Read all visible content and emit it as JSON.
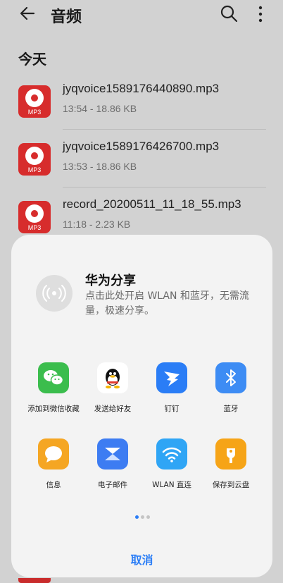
{
  "header": {
    "title": "音频"
  },
  "section_label": "今天",
  "files": [
    {
      "name": "jyqvoice1589176440890.mp3",
      "meta": "13:54 - 18.86 KB",
      "badge": "MP3"
    },
    {
      "name": "jyqvoice1589176426700.mp3",
      "meta": "13:53 - 18.86 KB",
      "badge": "MP3"
    },
    {
      "name": "record_20200511_11_18_55.mp3",
      "meta": "11:18 - 2.23 KB",
      "badge": "MP3"
    }
  ],
  "share": {
    "huawei_title": "华为分享",
    "huawei_desc": "点击此处开启 WLAN 和蓝牙，无需流量，极速分享。",
    "apps": [
      {
        "label": "添加到微信收藏",
        "icon": "wechat-icon"
      },
      {
        "label": "发送给好友",
        "icon": "qq-icon"
      },
      {
        "label": "钉钉",
        "icon": "dingtalk-icon"
      },
      {
        "label": "蓝牙",
        "icon": "bluetooth-icon"
      },
      {
        "label": "信息",
        "icon": "messages-icon"
      },
      {
        "label": "电子邮件",
        "icon": "email-icon"
      },
      {
        "label": "WLAN 直连",
        "icon": "wlan-direct-icon"
      },
      {
        "label": "保存到云盘",
        "icon": "cloud-drive-icon"
      }
    ],
    "cancel_label": "取消",
    "page_count": 3,
    "active_page": 1
  },
  "colors": {
    "accent": "#2a7df6",
    "mp3_red": "#d72c2c",
    "sheet_bg": "#f3f3f3"
  }
}
